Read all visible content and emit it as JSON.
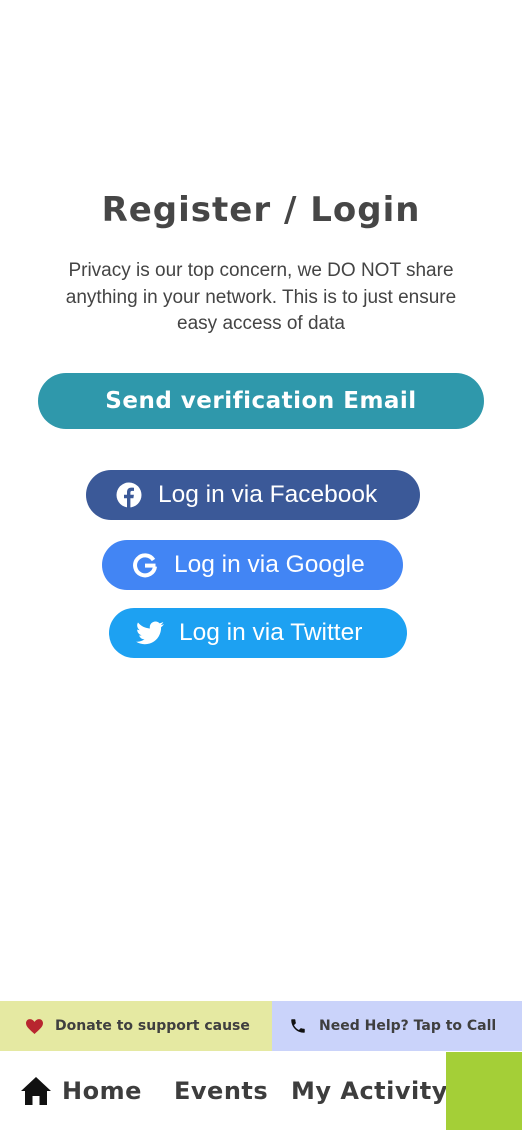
{
  "header": {
    "title": "Register / Login",
    "subtitle": "Privacy is our top concern, we DO NOT share anything in your network. This is to just ensure easy access of data"
  },
  "actions": {
    "email_button": "Send verification Email",
    "facebook_button": "Log in via Facebook",
    "google_button": "Log in via Google",
    "twitter_button": "Log in via Twitter"
  },
  "support_bar": {
    "donate_label": "Donate to support cause",
    "help_label": "Need Help? Tap to Call"
  },
  "nav": {
    "items": [
      {
        "label": "Home",
        "icon": "home-icon"
      },
      {
        "label": "Events"
      },
      {
        "label": "My Activity"
      }
    ]
  },
  "colors": {
    "primary": "#2f98ab",
    "facebook": "#3b5998",
    "google": "#4285f4",
    "twitter": "#1da1f2",
    "donate_bg": "#e5e9a2",
    "help_bg": "#cad3fa",
    "accent_green": "#a4cf37"
  }
}
